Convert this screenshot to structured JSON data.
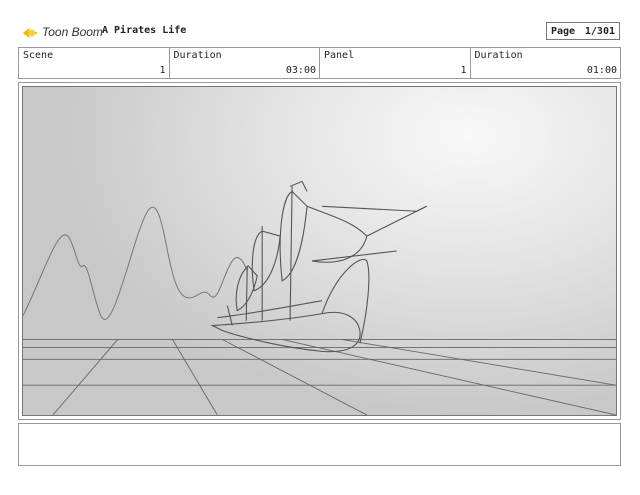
{
  "header": {
    "logo_text": "Toon Boom",
    "project_title": "A Pirates Life",
    "page_label": "Page",
    "page_value": "1/301"
  },
  "info": {
    "scene_label": "Scene",
    "scene_value": "1",
    "scene_duration_label": "Duration",
    "scene_duration_value": "03:00",
    "panel_label": "Panel",
    "panel_value": "1",
    "panel_duration_label": "Duration",
    "panel_duration_value": "01:00"
  },
  "icons": {
    "logo": "toon-boom-logo-icon"
  },
  "colors": {
    "logo_yellow": "#f2b705",
    "sketch_line": "#555555"
  }
}
